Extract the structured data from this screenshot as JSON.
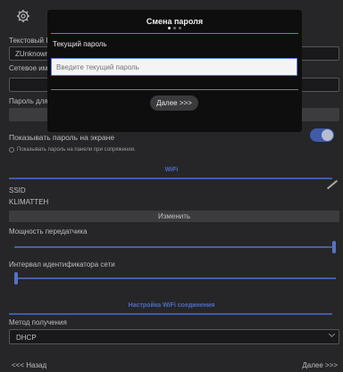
{
  "toolbar": {
    "settings_icon": "gear-icon"
  },
  "form": {
    "text_id_label": "Текстовый ID",
    "text_id_value": "ZUnknown",
    "network_label": "Сетевое имя",
    "network_value": "",
    "password_label": "Пароль для сопряжения",
    "show_password_label": "Показывать пароль на экране",
    "show_password_hint": "Показывать пароль на панели при сопряжении.",
    "toggle_on": true
  },
  "wifi": {
    "header": "WiFi",
    "ssid_label": "SSID",
    "ssid_value": "KLIMATTEH",
    "change_button": "Изменить",
    "power_label": "Мощность передатчика",
    "power_level": 1.0,
    "interval_label": "Интервал идентификатора сети",
    "interval_level": 0.0
  },
  "connection": {
    "header": "Настройка WiFi соединения",
    "method_label": "Метод получения",
    "method_value": "DHCP"
  },
  "footer": {
    "back": "<<< Назад",
    "next": "Далее >>>"
  },
  "modal": {
    "title": "Смена пароля",
    "field_label": "Текущий пароль",
    "placeholder": "Введите текущий пароль",
    "next_button": "Далее >>>",
    "page_dots": 3,
    "active_dot": 0
  },
  "colors": {
    "accent": "#4d6fd0",
    "background": "#2f2f31",
    "modal": "#0e0e0f"
  }
}
